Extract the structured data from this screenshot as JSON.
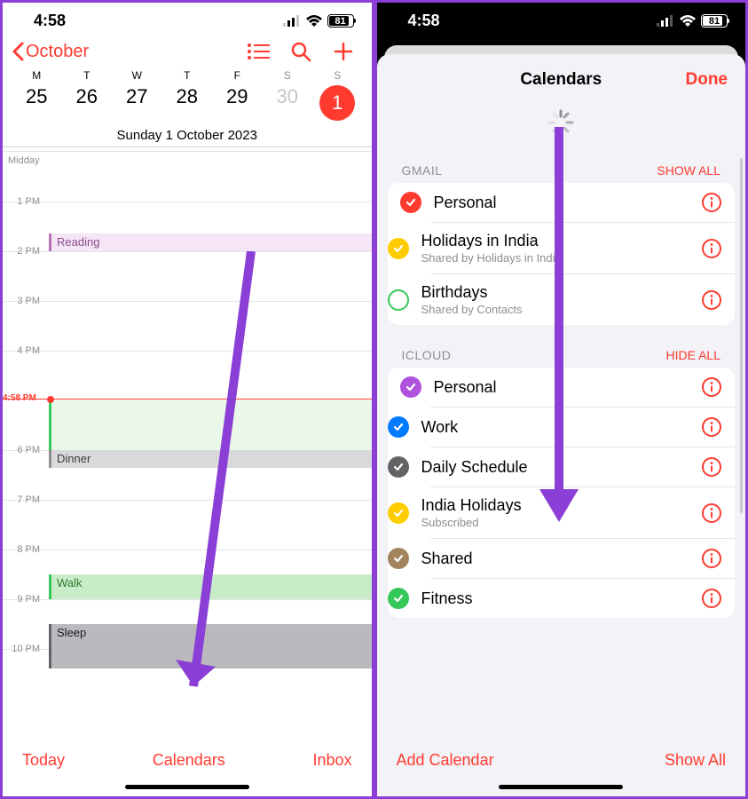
{
  "status": {
    "time": "4:58",
    "battery": "81"
  },
  "p1": {
    "back": "October",
    "weekdays": [
      "M",
      "T",
      "W",
      "T",
      "F",
      "S",
      "S"
    ],
    "dates": [
      "25",
      "26",
      "27",
      "28",
      "29",
      "30",
      "1"
    ],
    "date_line": "Sunday  1 October 2023",
    "midday": "Midday",
    "hours": {
      "h1": "1 PM",
      "h2": "2 PM",
      "h3": "3 PM",
      "h4": "4 PM",
      "h6": "6 PM",
      "h7": "7 PM",
      "h8": "8 PM",
      "h9": "9 PM",
      "h10": "10 PM"
    },
    "now": "4:58 PM",
    "events": {
      "reading": {
        "label": "Reading",
        "bg": "#f5e5f7",
        "border": "#b76eb5",
        "text": "#8a4f88"
      },
      "dinner": {
        "label": "Dinner",
        "bg": "#d9d9dc",
        "border": "#8e8e93",
        "text": "#3a3a3c"
      },
      "walk": {
        "label": "Walk",
        "bg": "#c8ecc8",
        "border": "#34c759",
        "text": "#2a7a2e"
      },
      "sleep": {
        "label": "Sleep",
        "bg": "#b9b9be",
        "border": "#636366",
        "text": "#1c1c1e"
      }
    },
    "green_block_bg": "#e9f8e9",
    "bottom": {
      "today": "Today",
      "calendars": "Calendars",
      "inbox": "Inbox"
    }
  },
  "p2": {
    "title": "Calendars",
    "done": "Done",
    "gmail_head": "GMAIL",
    "gmail_action": "SHOW ALL",
    "icloud_head": "ICLOUD",
    "icloud_action": "HIDE ALL",
    "gmail": [
      {
        "name": "Personal",
        "sub": "",
        "color": "#ff3b30",
        "checked": true,
        "outline": false
      },
      {
        "name": "Holidays in India",
        "sub": "Shared by Holidays in India",
        "color": "#ffcc00",
        "checked": true,
        "outline": false
      },
      {
        "name": "Birthdays",
        "sub": "Shared by Contacts",
        "color": "#34c759",
        "checked": false,
        "outline": true
      }
    ],
    "icloud": [
      {
        "name": "Personal",
        "sub": "",
        "color": "#af52de",
        "checked": true
      },
      {
        "name": "Work",
        "sub": "",
        "color": "#007aff",
        "checked": true
      },
      {
        "name": "Daily Schedule",
        "sub": "",
        "color": "#636366",
        "checked": true
      },
      {
        "name": "India Holidays",
        "sub": "Subscribed",
        "color": "#ffcc00",
        "checked": true
      },
      {
        "name": "Shared",
        "sub": "",
        "color": "#a2845e",
        "checked": true
      },
      {
        "name": "Fitness",
        "sub": "",
        "color": "#34c759",
        "checked": true
      }
    ],
    "footer": {
      "add": "Add Calendar",
      "show": "Show All"
    }
  }
}
